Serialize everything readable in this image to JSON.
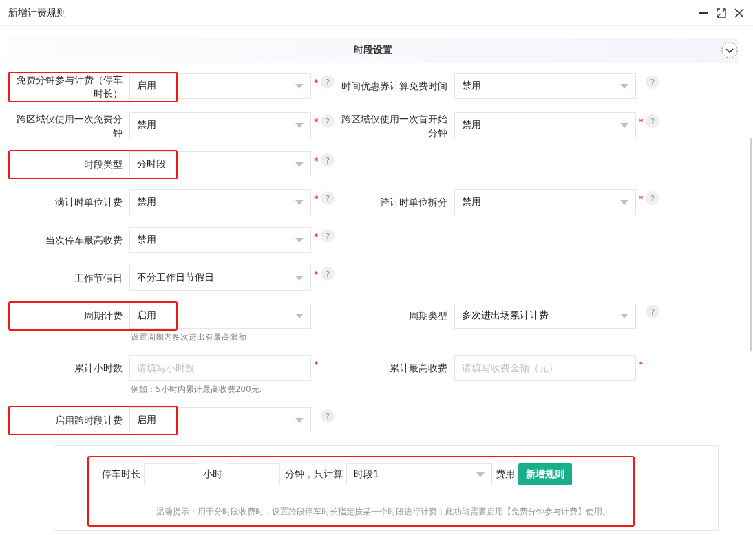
{
  "window": {
    "title": "新增计费规则"
  },
  "section": {
    "title": "时段设置",
    "expanded": true
  },
  "rows": [
    {
      "fields": [
        {
          "label": "免费分钟参与计费（停车时长）",
          "kind": "select",
          "value": "启用",
          "required": "*",
          "help": "?",
          "highlighted": true
        },
        {
          "label": "时间优惠券计算免费时间",
          "kind": "select",
          "value": "禁用",
          "help": "?"
        }
      ]
    },
    {
      "fields": [
        {
          "label": "跨区域仅使用一次免费分钟",
          "kind": "select",
          "value": "禁用",
          "required": "*",
          "help": "?"
        },
        {
          "label": "跨区域仅使用一次首开始分钟",
          "kind": "select",
          "value": "禁用",
          "required": "*",
          "help": "?"
        }
      ]
    },
    {
      "fields": [
        {
          "label": "时段类型",
          "kind": "select",
          "value": "分时段",
          "required": "*",
          "help": "?",
          "highlighted": true
        }
      ]
    },
    {
      "fields": [
        {
          "label": "满计时单位计费",
          "kind": "select",
          "value": "禁用",
          "required": "*",
          "help": "?"
        },
        {
          "label": "跨计时单位拆分",
          "kind": "select",
          "value": "禁用",
          "required": "*",
          "help": "?"
        }
      ]
    },
    {
      "fields": [
        {
          "label": "当次停车最高收费",
          "kind": "select",
          "value": "禁用",
          "required": "*",
          "help": "?"
        }
      ]
    },
    {
      "fields": [
        {
          "label": "工作节假日",
          "kind": "select",
          "value": "不分工作日节假日",
          "required": "*",
          "help": "?"
        }
      ]
    },
    {
      "fields": [
        {
          "label": "周期计费",
          "kind": "select",
          "value": "启用",
          "highlighted": true,
          "hint": "设置周期内多次进出有最高限额"
        },
        {
          "label": "周期类型",
          "kind": "select",
          "value": "多次进出场累计计费",
          "help": "?"
        }
      ]
    },
    {
      "fields": [
        {
          "label": "累计小时数",
          "kind": "input",
          "placeholder": "请填写小时数",
          "required": "*",
          "hint": "例如：5小时内累计最高收费200元."
        },
        {
          "label": "累计最高收费",
          "kind": "input",
          "placeholder": "请填写收费金额（元）",
          "required": "*"
        }
      ]
    },
    {
      "fields": [
        {
          "label": "启用跨时段计费",
          "kind": "select",
          "value": "启用",
          "help": "?",
          "highlighted": true
        }
      ]
    }
  ],
  "panel": {
    "highlighted": true,
    "items": [
      {
        "kind": "text",
        "text": "停车时长"
      },
      {
        "kind": "input"
      },
      {
        "kind": "text",
        "text": "小时"
      },
      {
        "kind": "input"
      },
      {
        "kind": "text",
        "text": "分钟，只计算"
      },
      {
        "kind": "select",
        "value": "时段1"
      },
      {
        "kind": "text",
        "text": "费用"
      },
      {
        "kind": "button",
        "label": "新增规则"
      }
    ],
    "hint": "温馨提示：用于分时段收费时，设置跨段停车时长指定按某一个时段进行计费；此功能需要启用【免费分钟参与计费】使用。"
  }
}
